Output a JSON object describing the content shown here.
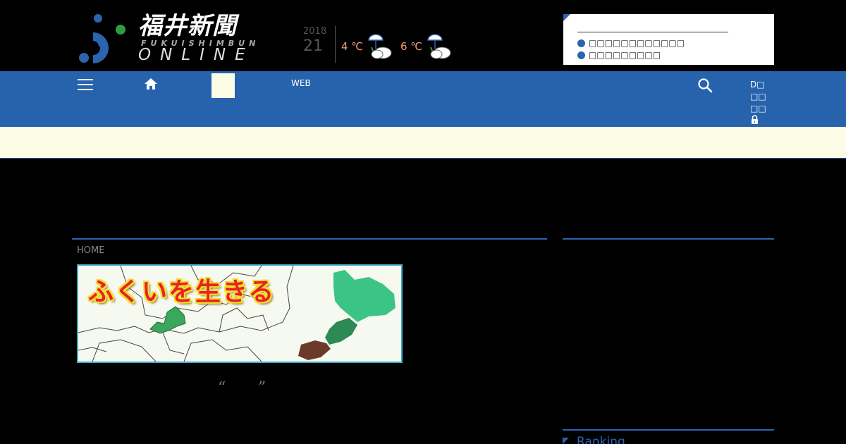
{
  "header": {
    "logo_jp": "福井新聞",
    "logo_sub": "FUKUISHIMBUN",
    "logo_online": "ONLINE",
    "date": {
      "year": "2018",
      "day": "21"
    },
    "weather": [
      {
        "temp": "4 ℃",
        "icon": "rain-cloud-icon"
      },
      {
        "temp": "6 ℃",
        "icon": "rain-cloud-icon"
      }
    ],
    "notice_items": [
      "□□□□□□□□□□□□",
      "□□□□□□□□□"
    ]
  },
  "nav": {
    "menu_icon": "hamburger-icon",
    "home_icon": "home-icon",
    "web_label": "WEB",
    "search_icon": "search-icon",
    "d_label_lines": [
      "D□",
      "□□",
      "□□"
    ],
    "lock_icon": "lock-icon"
  },
  "colors": {
    "nav_blue": "#2762ad",
    "accent_blue": "#2a64b0",
    "cream": "#fbfbe6",
    "temp_orange": "#f0a070"
  },
  "main": {
    "breadcrumb": "HOME",
    "banner_title": "ふくいを生きる",
    "quote_open": "“",
    "quote_close": "”"
  },
  "sidebar": {
    "ranking_title": "Ranking"
  }
}
